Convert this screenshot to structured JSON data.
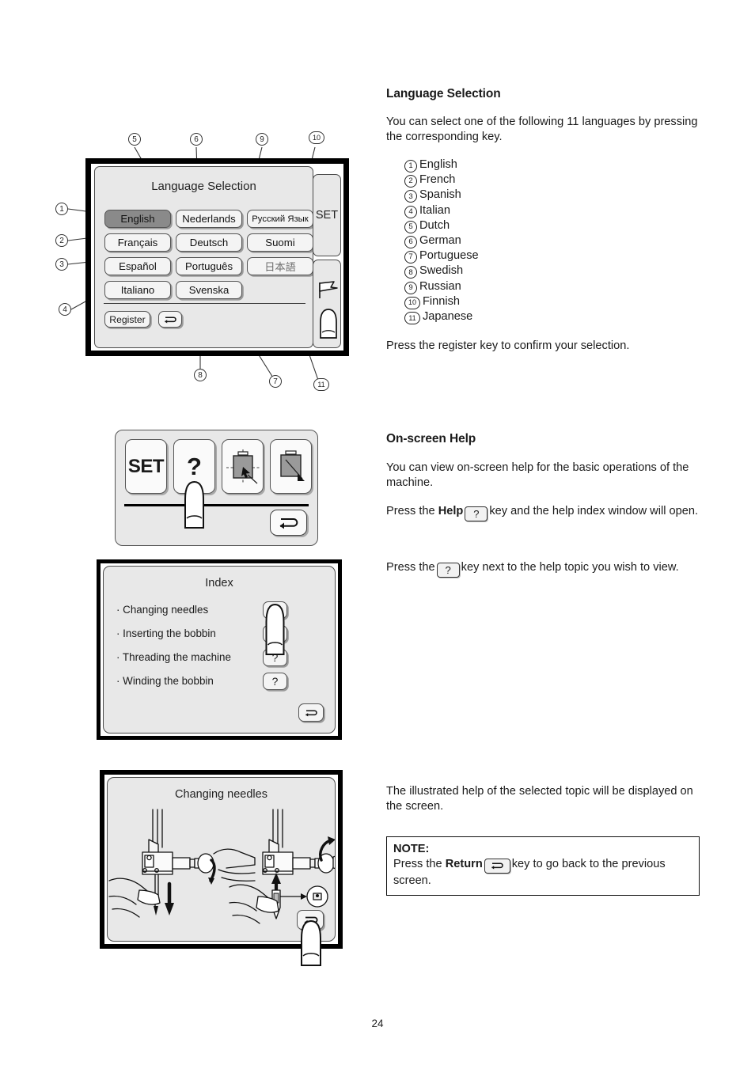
{
  "page": {
    "number": "24"
  },
  "sections": {
    "language": {
      "heading": "Language Selection",
      "intro": "You can select one of the following 11 languages by pressing the corresponding key.",
      "items": [
        {
          "num": "1",
          "label": "English"
        },
        {
          "num": "2",
          "label": "French"
        },
        {
          "num": "3",
          "label": "Spanish"
        },
        {
          "num": "4",
          "label": "Italian"
        },
        {
          "num": "5",
          "label": "Dutch"
        },
        {
          "num": "6",
          "label": "German"
        },
        {
          "num": "7",
          "label": "Portuguese"
        },
        {
          "num": "8",
          "label": "Swedish"
        },
        {
          "num": "9",
          "label": "Russian"
        },
        {
          "num": "10",
          "label": "Finnish"
        },
        {
          "num": "11",
          "label": "Japanese"
        }
      ],
      "outro": "Press the register key to confirm your selection."
    },
    "help": {
      "heading": "On-screen Help",
      "para1": "You can view on-screen help for the basic operations of the machine.",
      "para2_a": "Press the",
      "para2_bold": "Help",
      "para2_key": "?",
      "para2_b": "key and the help index window will open.",
      "para3_a": "Press the",
      "para3_key": "?",
      "para3_b": "key next to the help topic you wish to view."
    },
    "illustrated": {
      "para": "The illustrated help of the selected topic will be displayed on the screen.",
      "note_label": "NOTE:",
      "note_a": "Press the",
      "note_bold": "Return",
      "note_key": "↵",
      "note_b": "key to go back to the previous screen."
    }
  },
  "fig_language_screen": {
    "title": "Language Selection",
    "set_tab_label": "SET",
    "register_label": "Register",
    "return_icon": "return-arrow-icon",
    "flag_icon": "flag-icon",
    "finger_icon": "fingertip-icon",
    "selected_language": "English",
    "buttons": [
      {
        "label": "English",
        "col": 0,
        "row": 0,
        "selected": true,
        "callout": "1"
      },
      {
        "label": "Français",
        "col": 0,
        "row": 1,
        "selected": false,
        "callout": "2"
      },
      {
        "label": "Español",
        "col": 0,
        "row": 2,
        "selected": false,
        "callout": "3"
      },
      {
        "label": "Italiano",
        "col": 0,
        "row": 3,
        "selected": false,
        "callout": "4"
      },
      {
        "label": "Nederlands",
        "col": 1,
        "row": 0,
        "selected": false,
        "callout": "5"
      },
      {
        "label": "Deutsch",
        "col": 1,
        "row": 1,
        "selected": false,
        "callout": "6"
      },
      {
        "label": "Português",
        "col": 1,
        "row": 2,
        "selected": false,
        "callout": "7"
      },
      {
        "label": "Svenska",
        "col": 1,
        "row": 3,
        "selected": false,
        "callout": "8"
      },
      {
        "label": "Русский Язык",
        "col": 2,
        "row": 0,
        "selected": false,
        "callout": "9"
      },
      {
        "label": "Suomi",
        "col": 2,
        "row": 1,
        "selected": false,
        "callout": "10"
      },
      {
        "label": "日本語",
        "col": 2,
        "row": 2,
        "selected": false,
        "callout": "11"
      }
    ],
    "callouts": [
      "1",
      "2",
      "3",
      "4",
      "5",
      "6",
      "7",
      "8",
      "9",
      "10",
      "11"
    ]
  },
  "fig_keybar": {
    "keys": [
      {
        "name": "set-key",
        "label": "SET"
      },
      {
        "name": "help-key",
        "label": "?"
      },
      {
        "name": "screen-position-key",
        "label": ""
      },
      {
        "name": "screen-contrast-key",
        "label": ""
      }
    ],
    "return_icon": "return-arrow-icon",
    "finger_icon": "fingertip-icon"
  },
  "fig_index": {
    "title": "Index",
    "rows": [
      {
        "label": "· Changing needles",
        "key": "?"
      },
      {
        "label": "· Inserting the bobbin",
        "key": "?"
      },
      {
        "label": "· Threading the machine",
        "key": "?"
      },
      {
        "label": "· Winding the bobbin",
        "key": "?"
      }
    ],
    "return_icon": "return-arrow-icon",
    "finger_icon": "fingertip-icon"
  },
  "fig_needle": {
    "title": "Changing needles",
    "return_icon": "return-arrow-icon",
    "finger_icon": "fingertip-icon"
  },
  "colors": {
    "lcd_background": "#e8e8e8",
    "key_face": "#f4f4f4",
    "key_shadow": "#9a9a9a",
    "selected_key": "#8a8a8a",
    "bezel": "#000000",
    "text": "#1a1a1a"
  }
}
